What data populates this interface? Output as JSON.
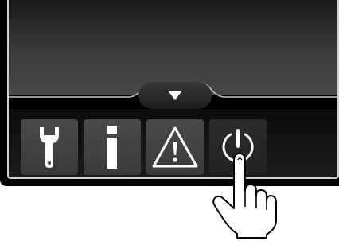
{
  "panel": {
    "collapse_toggle_icon": "triangle-down-icon",
    "buttons": [
      {
        "id": "settings",
        "icon": "wrench-icon"
      },
      {
        "id": "info",
        "icon": "info-icon"
      },
      {
        "id": "warning",
        "icon": "warning-triangle-icon"
      },
      {
        "id": "power",
        "icon": "power-icon",
        "state": "pressed"
      }
    ]
  },
  "overlay": {
    "pointer": "pointing-hand-icon"
  },
  "colors": {
    "display_top": "#1a1a1a",
    "display_bottom": "#474747",
    "tile": "#444444",
    "tile_active": "#262626",
    "icon": "#ffffff",
    "frame": "#cfcfcf"
  }
}
